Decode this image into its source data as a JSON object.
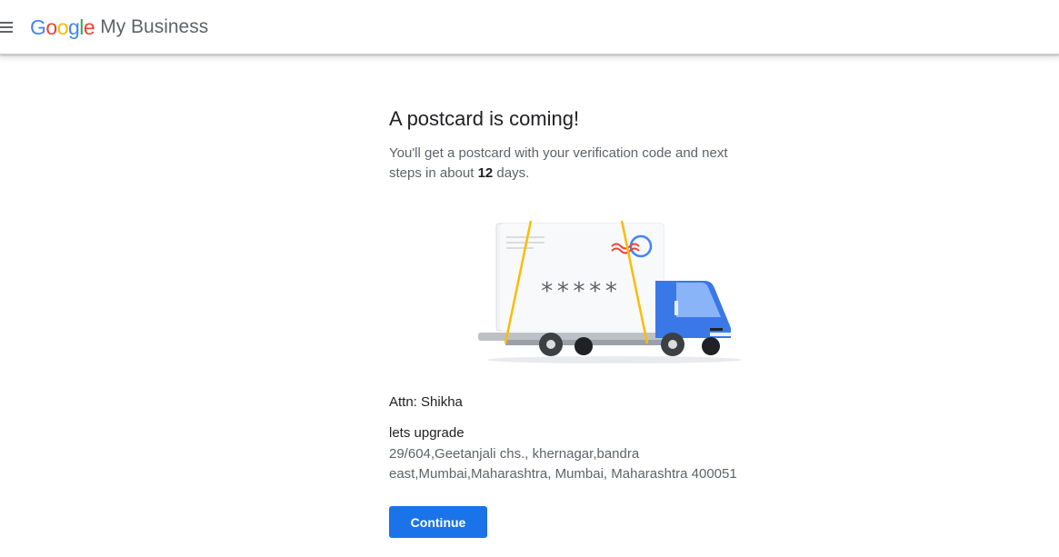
{
  "header": {
    "menu_icon": "hamburger-menu-icon",
    "logo": {
      "letters": [
        "G",
        "o",
        "o",
        "g",
        "l",
        "e"
      ]
    },
    "product_name": "My Business"
  },
  "main": {
    "title": "A postcard is coming!",
    "description_part1": "You'll get a postcard with your verification code and next steps in about ",
    "days": "12",
    "description_part2": " days.",
    "illustration": {
      "icon": "postcard-delivery-truck-illustration",
      "code_placeholder": "*****"
    },
    "attn": "Attn: Shikha",
    "business_name": "lets upgrade",
    "address": "29/604,Geetanjali chs., khernagar,bandra east,Mumbai,Maharashtra, Mumbai, Maharashtra 400051",
    "continue_label": "Continue"
  },
  "colors": {
    "primary_button": "#1a73e8",
    "truck_blue": "#3b78e7",
    "strap_yellow": "#fbbc04",
    "google_blue": "#4285f4",
    "google_red": "#ea4335",
    "google_yellow": "#fbbc05",
    "google_green": "#34a853"
  }
}
